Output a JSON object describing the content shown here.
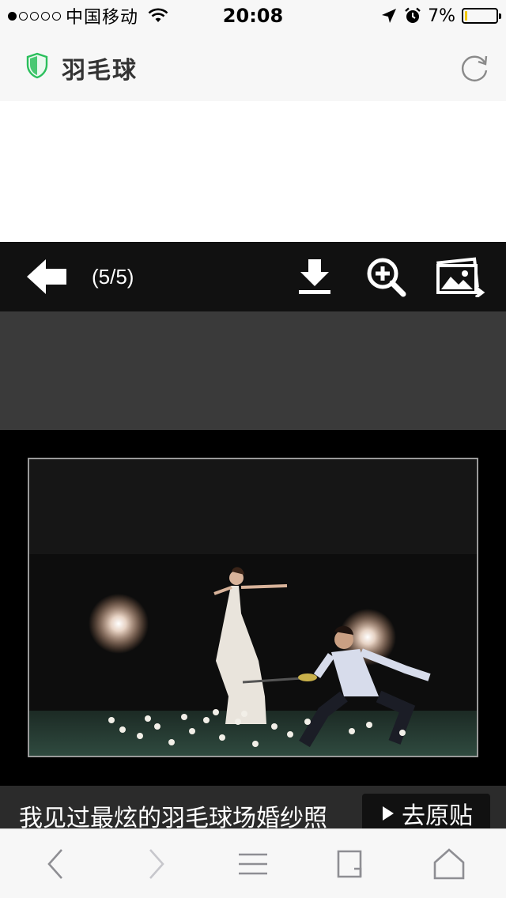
{
  "status_bar": {
    "signal_dots": [
      "filled",
      "empty",
      "empty",
      "empty",
      "empty"
    ],
    "carrier": "中国移动",
    "time": "20:08",
    "battery_percent_text": "7%",
    "battery_level": 0.07,
    "icons": [
      "wifi-icon",
      "location-arrow-icon",
      "alarm-icon",
      "battery-icon"
    ]
  },
  "header": {
    "title": "羽毛球",
    "shield_icon": "shield-icon",
    "refresh_icon": "refresh-icon",
    "accent_color": "#2bbf5c"
  },
  "viewer": {
    "page_counter": "(5/5)",
    "back_icon": "back-arrow-icon",
    "download_icon": "download-icon",
    "zoom_icon": "zoom-in-icon",
    "gallery_icon": "image-gallery-icon",
    "caption": "我见过最炫的羽毛球场婚纱照",
    "source_button_label": "去原贴"
  },
  "safari_toolbar": {
    "icons": [
      "back-icon",
      "forward-icon",
      "menu-icon",
      "tabs-icon",
      "home-icon"
    ]
  }
}
